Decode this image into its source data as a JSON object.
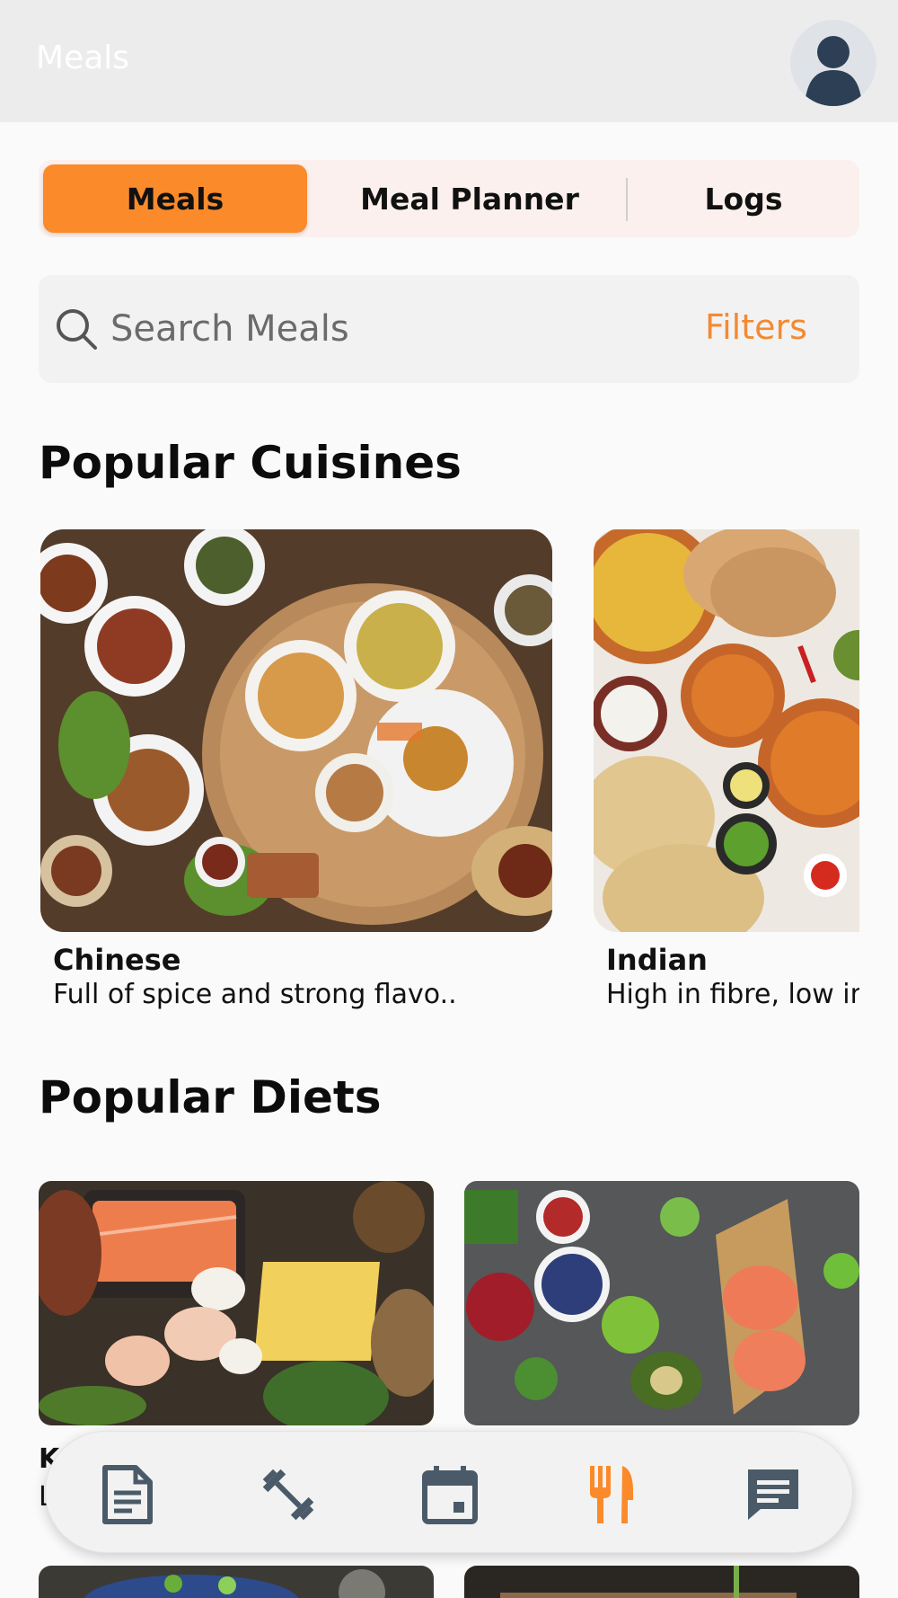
{
  "header": {
    "title": "Meals"
  },
  "tabs": [
    {
      "label": "Meals",
      "active": true
    },
    {
      "label": "Meal Planner",
      "active": false
    },
    {
      "label": "Logs",
      "active": false
    }
  ],
  "search": {
    "placeholder": "Search Meals",
    "filters_label": "Filters"
  },
  "sections": {
    "cuisines_title": "Popular Cuisines",
    "diets_title": "Popular Diets"
  },
  "cuisines": [
    {
      "name": "Chinese",
      "description": "Full of spice and strong flavo.."
    },
    {
      "name": "Indian",
      "description": "High in fibre, low in fat"
    }
  ],
  "diets": [
    {
      "name_peek": "K",
      "desc_peek": "L"
    }
  ],
  "bottom_nav": [
    {
      "icon": "document-icon",
      "active": false
    },
    {
      "icon": "dumbbell-icon",
      "active": false
    },
    {
      "icon": "calendar-icon",
      "active": false
    },
    {
      "icon": "fork-knife-icon",
      "active": true
    },
    {
      "icon": "chat-icon",
      "active": false
    }
  ],
  "colors": {
    "accent": "#fb8a2a",
    "nav_icon": "#4a5a68",
    "header_bg": "#ececed"
  }
}
